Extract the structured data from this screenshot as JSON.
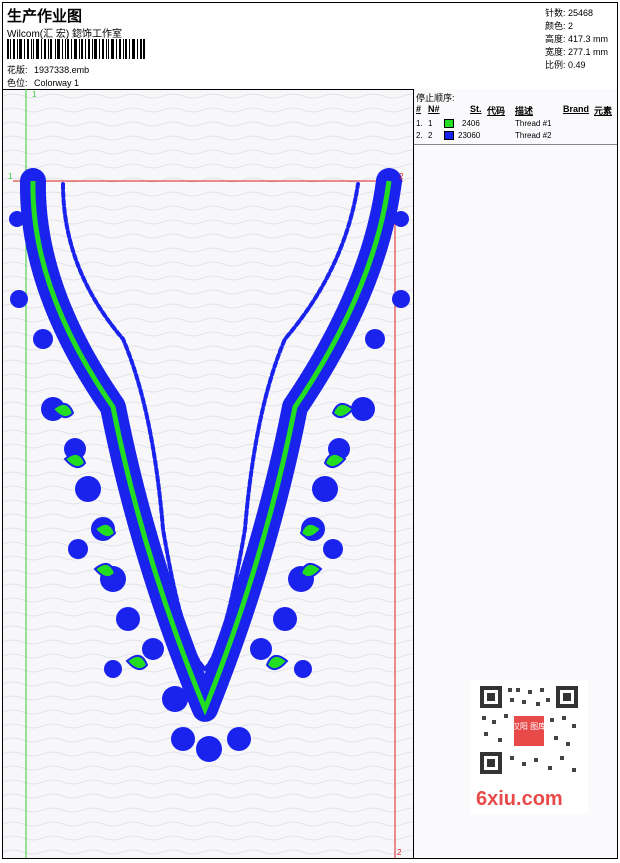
{
  "header": {
    "title": "生产作业图",
    "company": "Wilcom(汇 宏) 鍃饰工作室",
    "design_label": "花版:",
    "design_value": "1937338.emb",
    "colorway_label": "色位:",
    "colorway_value": "Colorway 1"
  },
  "stats": {
    "stitches": "针数: 25468",
    "colors": "颜色: 2",
    "height": "高度: 417.3 mm",
    "width": "宽度: 277.1 mm",
    "scale": "比例: 0.49"
  },
  "stops": {
    "heading": "停止顺序:",
    "columns": [
      "#",
      "N#",
      "St.",
      "代码",
      "描述",
      "Brand",
      "元素"
    ],
    "rows": [
      {
        "index": "1.",
        "stop": "1",
        "color": "#22dd22",
        "code": "2406",
        "desc": "Thread #1"
      },
      {
        "index": "2.",
        "stop": "2",
        "color": "#1a22ee",
        "code": "23060",
        "desc": "Thread #2"
      }
    ]
  },
  "markers": {
    "start_top": "1",
    "left_top": "1",
    "right_top": "2",
    "right_bottom": "2"
  },
  "colors": {
    "thread_green": "#22dd22",
    "thread_blue": "#1a22ee",
    "guide_green": "#33cc33",
    "guide_red": "#dd2222"
  },
  "watermark": {
    "text": "6xiu.com",
    "qr_label": "汉阳 图库"
  }
}
